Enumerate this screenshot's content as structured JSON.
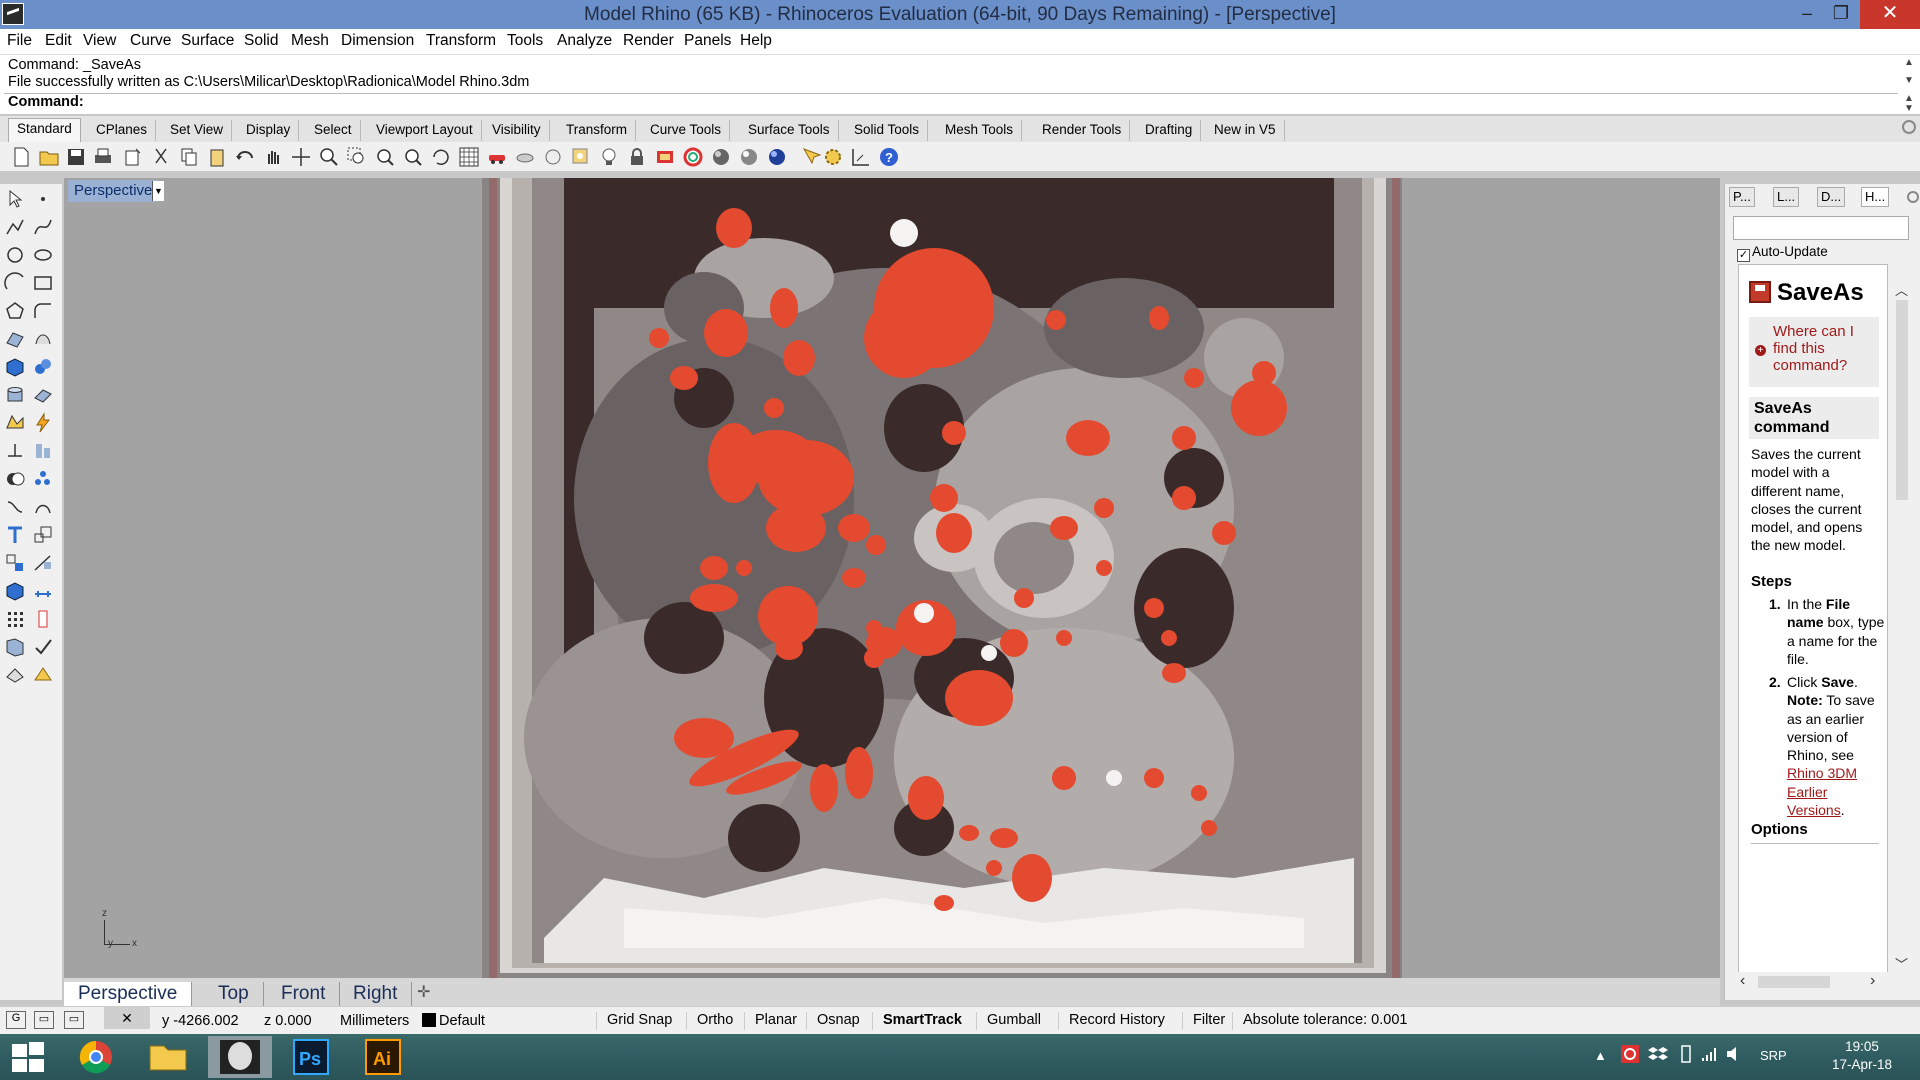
{
  "window": {
    "title": "Model Rhino (65 KB) - Rhinoceros Evaluation (64-bit, 90 Days Remaining) - [Perspective]"
  },
  "menu": [
    "File",
    "Edit",
    "View",
    "Curve",
    "Surface",
    "Solid",
    "Mesh",
    "Dimension",
    "Transform",
    "Tools",
    "Analyze",
    "Render",
    "Panels",
    "Help"
  ],
  "command": {
    "history1": "Command: _SaveAs",
    "history2": "File successfully written as C:\\Users\\Milicar\\Desktop\\Radionica\\Model Rhino.3dm",
    "prompt": "Command:"
  },
  "toolbar_tabs": [
    "Standard",
    "CPlanes",
    "Set View",
    "Display",
    "Select",
    "Viewport Layout",
    "Visibility",
    "Transform",
    "Curve Tools",
    "Surface Tools",
    "Solid Tools",
    "Mesh Tools",
    "Render Tools",
    "Drafting",
    "New in V5"
  ],
  "toolbar_icons": [
    "new-file-icon",
    "open-file-icon",
    "save-icon",
    "print-icon",
    "import-icon",
    "cut-icon",
    "copy-icon",
    "paste-icon",
    "undo-icon",
    "pan-icon",
    "move-view-icon",
    "zoom-icon",
    "zoom-window-icon",
    "zoom-extents-icon",
    "zoom-selected-icon",
    "rotate-view-icon",
    "viewport-layout-icon",
    "render-car-icon",
    "render-object-icon",
    "cplane-icon",
    "lights-icon",
    "bulb-icon",
    "lock-icon",
    "layer-icon",
    "color-wheel-icon",
    "material-sphere-icon",
    "shaded-sphere-icon",
    "render-sphere-icon",
    "select-tool-icon",
    "options-gear-icon",
    "snap-grid-icon",
    "help-icon"
  ],
  "viewport": {
    "label": "Perspective",
    "axis_y": "y",
    "axis_x": "x",
    "axis_z": "z"
  },
  "view_tabs": [
    "Perspective",
    "Top",
    "Front",
    "Right"
  ],
  "panel": {
    "tabs": [
      "P...",
      "L...",
      "D...",
      "H..."
    ],
    "auto_update": "Auto-Update",
    "help": {
      "title": "SaveAs",
      "where": "Where can I find this command?",
      "cmd_heading": "SaveAs command",
      "description": "Saves the current model with a different name, closes the current model, and opens the new model.",
      "steps_heading": "Steps",
      "step1_num": "1.",
      "step1_a": "In the ",
      "step1_b": "File name",
      "step1_c": " box, type a name for the file.",
      "step2_num": "2.",
      "step2_a": "Click ",
      "step2_b": "Save",
      "step2_c": ".",
      "note_label": "Note:",
      "note_text": " To save as an earlier version of Rhino, see ",
      "note_link": "Rhino 3DM Earlier Versions",
      "note_end": ".",
      "options_heading": "Options"
    }
  },
  "status": {
    "g_button": "G",
    "close_button": "✕",
    "y": "y -4266.002",
    "z": "z 0.000",
    "units": "Millimeters",
    "layer": "Default",
    "toggles": [
      "Grid Snap",
      "Ortho",
      "Planar",
      "Osnap",
      "SmartTrack",
      "Gumball",
      "Record History",
      "Filter"
    ],
    "tolerance": "Absolute tolerance: 0.001"
  },
  "taskbar": {
    "apps": [
      "chrome-icon",
      "file-explorer-icon",
      "photo-viewer-icon",
      "photoshop-icon",
      "illustrator-icon"
    ],
    "ps_label": "Ps",
    "ai_label": "Ai",
    "lang": "SRP",
    "time": "19:05",
    "date": "17-Apr-18"
  },
  "colors": {
    "accent_red": "#e34a2f",
    "dark_brown": "#3b2a2a",
    "title_blue": "#6b8fc9"
  }
}
